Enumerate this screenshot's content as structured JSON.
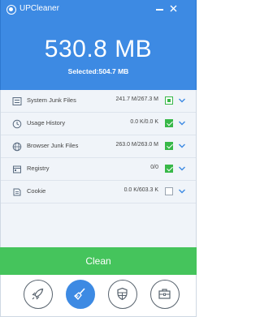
{
  "app": {
    "title": "UPCleaner"
  },
  "summary": {
    "total_size": "530.8 MB",
    "selected_text": "Selected:504.7 MB"
  },
  "items": [
    {
      "icon": "system-junk-icon",
      "label": "System Junk Files",
      "size": "241.7 M/267.3 M",
      "checked": "partial"
    },
    {
      "icon": "clock-icon",
      "label": "Usage History",
      "size": "0.0 K/0.0 K",
      "checked": "on"
    },
    {
      "icon": "globe-icon",
      "label": "Browser Junk Files",
      "size": "263.0 M/263.0 M",
      "checked": "on"
    },
    {
      "icon": "registry-icon",
      "label": "Registry",
      "size": "0/0",
      "checked": "on"
    },
    {
      "icon": "cookie-icon",
      "label": "Cookie",
      "size": "0.0 K/603.3 K",
      "checked": "off"
    }
  ],
  "actions": {
    "clean_label": "Clean"
  },
  "bottom_nav": [
    {
      "icon": "rocket-icon",
      "active": false
    },
    {
      "icon": "broom-icon",
      "active": true
    },
    {
      "icon": "shield-icon",
      "active": false
    },
    {
      "icon": "toolbox-icon",
      "active": false
    }
  ],
  "colors": {
    "primary": "#3d8ae3",
    "clean": "#45c45c",
    "check": "#38b848"
  }
}
